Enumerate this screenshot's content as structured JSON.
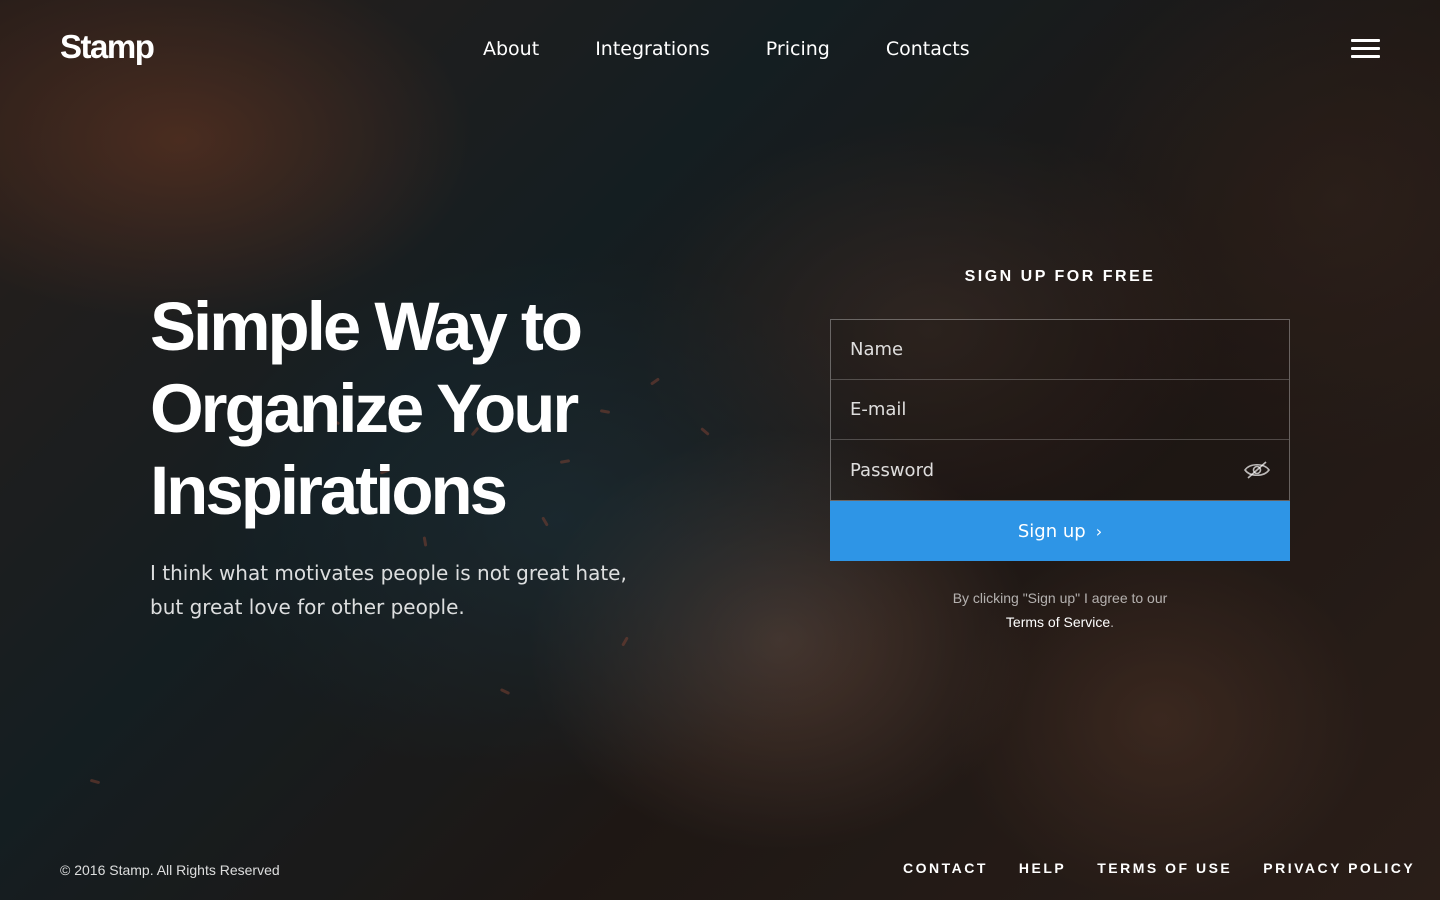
{
  "brand": {
    "logo": "Stamp"
  },
  "nav": {
    "items": [
      {
        "label": "About"
      },
      {
        "label": "Integrations"
      },
      {
        "label": "Pricing"
      },
      {
        "label": "Contacts"
      }
    ],
    "menu_icon": "hamburger-menu-icon"
  },
  "hero": {
    "headline": "Simple Way to Organize Your Inspirations",
    "subtext": "I think what motivates people is not great hate, but great love for other people."
  },
  "signup": {
    "title": "SIGN UP FOR FREE",
    "name_placeholder": "Name",
    "email_placeholder": "E-mail",
    "password_placeholder": "Password",
    "password_toggle_icon": "eye-slash-icon",
    "button_label": "Sign up",
    "button_icon": "chevron-right-icon",
    "button_color": "#2e95e6",
    "terms_prefix": "By clicking \"Sign up\" I agree to our",
    "terms_link": "Terms of Service",
    "terms_suffix": "."
  },
  "footer": {
    "copyright": "© 2016 Stamp. All Rights Reserved",
    "links": [
      {
        "label": "CONTACT"
      },
      {
        "label": "HELP"
      },
      {
        "label": "TERMS OF USE"
      },
      {
        "label": "PRIVACY POLICY"
      }
    ]
  }
}
